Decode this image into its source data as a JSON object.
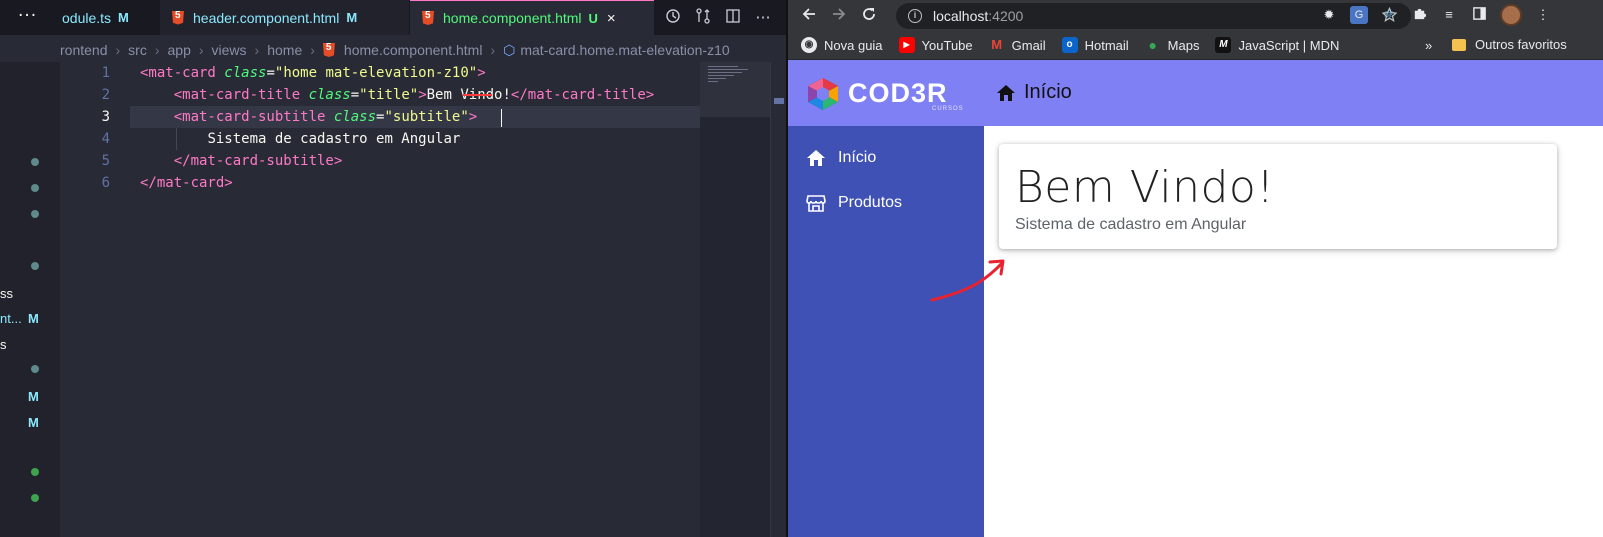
{
  "vscode": {
    "tabs": [
      {
        "name": "odule.ts",
        "status": "M"
      },
      {
        "name": "header.component.html",
        "status": "M"
      },
      {
        "name": "home.component.html",
        "status": "U",
        "close": "×"
      }
    ],
    "breadcrumb": [
      "rontend",
      "src",
      "app",
      "views",
      "home",
      "home.component.html",
      "mat-card.home.mat-elevation-z10"
    ],
    "line_numbers": [
      "1",
      "2",
      "3",
      "4",
      "5",
      "6"
    ],
    "code": {
      "l1": {
        "open": "<mat-card ",
        "attr": "class",
        "eq": "=",
        "val1": "\"home mat-elevation-",
        "val2": "z10",
        "val3": "\"",
        "close": ">"
      },
      "l2": {
        "open": "<mat-card-title ",
        "attr": "class",
        "eq": "=",
        "val": "\"title\"",
        "close": ">",
        "text": "Bem Vindo!",
        "end": "</mat-card-title>"
      },
      "l3": {
        "open": "<mat-card-subtitle ",
        "attr": "class",
        "eq": "=",
        "val": "\"subtitle\"",
        "close": ">"
      },
      "l4": {
        "text": "Sistema de cadastro em Angular"
      },
      "l5": {
        "end": "</mat-card-subtitle>"
      },
      "l6": {
        "end": "</mat-card>"
      }
    },
    "explorer_fragments": [
      "ss",
      "nt...",
      "s"
    ],
    "explorer_badges": [
      "M",
      "M",
      "M"
    ]
  },
  "browser": {
    "url_host": "localhost",
    "url_port": ":4200",
    "bookmarks": [
      "Nova guia",
      "YouTube",
      "Gmail",
      "Hotmail",
      "Maps",
      "JavaScript | MDN"
    ],
    "bookmarks_more": "»",
    "bookmarks_folder": "Outros favoritos"
  },
  "app": {
    "logo_text": "COD3R",
    "logo_sub": "CURSOS",
    "header_title": "Início",
    "nav": [
      {
        "label": "Início",
        "icon": "home-icon"
      },
      {
        "label": "Produtos",
        "icon": "storefront-icon"
      }
    ],
    "card": {
      "title": "Bem Vindo!",
      "subtitle": "Sistema de cadastro em Angular"
    },
    "colors": {
      "header": "#8080f5",
      "sidenav": "#3f51b5",
      "annotation_arrow": "#e8222f"
    }
  }
}
